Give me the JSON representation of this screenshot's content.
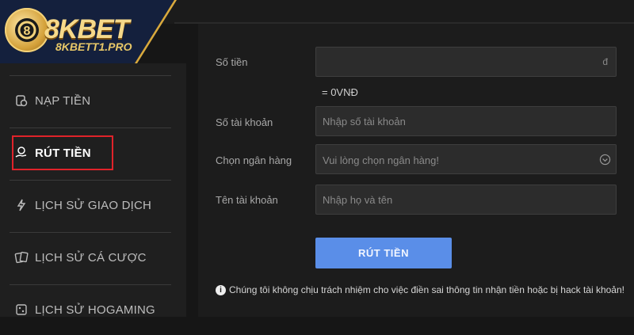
{
  "brand": {
    "name": "8KBET",
    "domain": "8KBETT1.PRO"
  },
  "sidebar": {
    "items": [
      {
        "label": "NẠP TIỀN",
        "icon": "deposit-icon"
      },
      {
        "label": "RÚT TIỀN",
        "icon": "withdraw-icon",
        "active": true
      },
      {
        "label": "LỊCH SỬ GIAO DỊCH",
        "icon": "transaction-history-icon"
      },
      {
        "label": "LỊCH SỬ CÁ CƯỢC",
        "icon": "cards-icon"
      },
      {
        "label": "LỊCH SỬ HOGAMING",
        "icon": "dice-icon"
      }
    ]
  },
  "form": {
    "amount_label": "Số tiền",
    "amount_value": "",
    "amount_suffix": "đ",
    "conversion": "= 0VNĐ",
    "account_number_label": "Số tài khoản",
    "account_number_placeholder": "Nhập số tài khoản",
    "bank_label": "Chọn ngân hàng",
    "bank_placeholder": "Vui lòng chọn ngân hàng!",
    "account_name_label": "Tên tài khoản",
    "account_name_placeholder": "Nhập họ và tên",
    "submit_label": "RÚT TIỀN",
    "notice": "Chúng tôi không chịu trách nhiệm cho việc điền sai thông tin nhận tiền hoặc bị hack tài khoản!"
  },
  "colors": {
    "accent": "#5a8ee8",
    "highlight": "#e0232a",
    "gold": "#d9a93c"
  }
}
